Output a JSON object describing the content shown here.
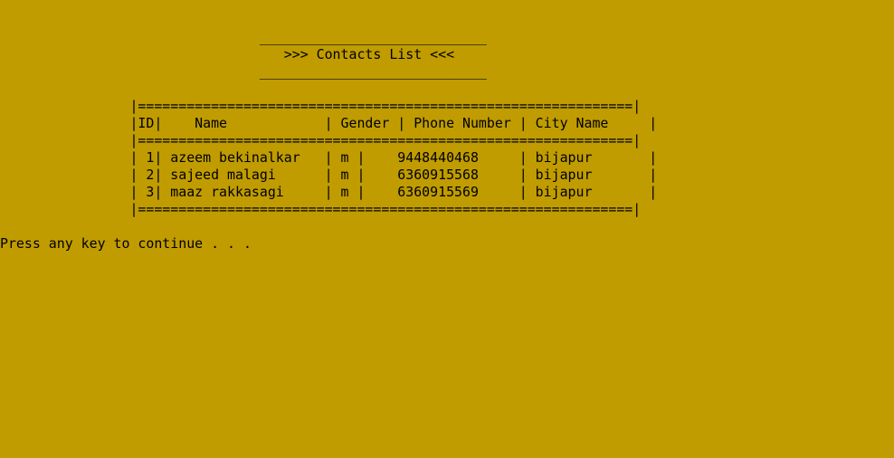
{
  "theme": {
    "background": "#c09c00",
    "text": "#000000"
  },
  "console": {
    "title_rule_top": "                                ____________________________",
    "title": "                                   >>> Contacts List <<<",
    "title_rule_bottom": "                                ____________________________",
    "blank1": "",
    "table_rule_top": "                |=============================================================|",
    "table_header": "                |ID|    Name            | Gender | Phone Number | City Name     |",
    "table_rule_mid": "                |=============================================================|",
    "rows": [
      "                | 1| azeem bekinalkar   | m |    9448440468     | bijapur       |",
      "                | 2| sajeed malagi      | m |    6360915568     | bijapur       |",
      "                | 3| maaz rakkasagi     | m |    6360915569     | bijapur       |"
    ],
    "table_rule_bottom": "                |=============================================================|",
    "blank2": "",
    "prompt": "Press any key to continue . . ."
  }
}
